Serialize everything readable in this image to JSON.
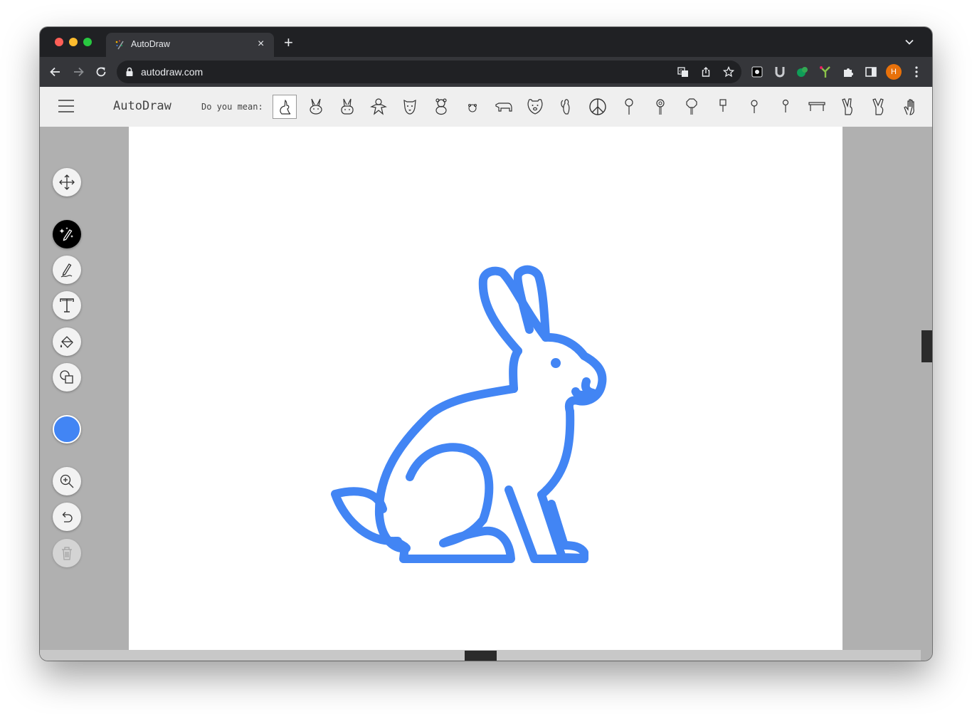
{
  "browser": {
    "tab": {
      "title": "AutoDraw",
      "favicon": "autodraw-favicon-icon"
    },
    "new_tab_label": "+",
    "close_label": "×",
    "url": "autodraw.com",
    "avatar_initial": "H"
  },
  "app": {
    "title": "AutoDraw",
    "suggest_label": "Do you mean:",
    "suggestions": [
      "rabbit-sitting-icon",
      "bunny-face-icon",
      "bunny-face-2-icon",
      "gingerbread-icon",
      "dog-face-icon",
      "teddy-bear-icon",
      "bear-small-icon",
      "bear-walking-icon",
      "bear-face-icon",
      "squirrel-icon",
      "peace-sign-icon",
      "lollipop-icon",
      "sign-icon",
      "stop-sign-icon",
      "signpost-icon",
      "pin-icon",
      "pin-2-icon",
      "table-icon",
      "peace-hand-icon",
      "peace-hand-2-icon",
      "hand-icon"
    ],
    "selected_suggestion": 0,
    "stroke_color": "#4285f4",
    "tools": [
      "move",
      "autodraw",
      "draw",
      "type",
      "fill",
      "shape",
      "color",
      "zoom",
      "undo",
      "delete"
    ]
  }
}
